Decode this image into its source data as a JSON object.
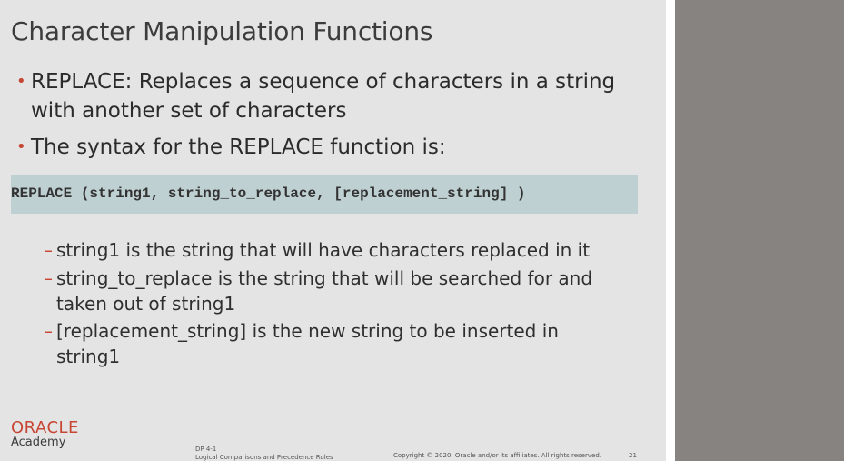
{
  "slide": {
    "title": "Character Manipulation Functions",
    "bullets": [
      {
        "line1": "REPLACE: Replaces a sequence of characters in a string",
        "line2": "with another set of characters"
      },
      {
        "line1": "The syntax for the REPLACE function is:"
      }
    ],
    "code": "REPLACE (string1, string_to_replace, [replacement_string] )",
    "sub_bullets": [
      {
        "line1": "string1 is the string that will have characters replaced in it"
      },
      {
        "line1": "string_to_replace is the string that will be searched for and",
        "line2": "taken out of string1"
      },
      {
        "line1": "[replacement_string] is the new string to be inserted in",
        "line2": "string1"
      }
    ],
    "logo": {
      "brand": "ORACLE",
      "sub": "Academy"
    },
    "footer": {
      "code": "DP 4-1",
      "topic": "Logical Comparisons and Precedence Rules",
      "copyright": "Copyright © 2020, Oracle and/or its affiliates. All rights reserved.",
      "page": "21"
    },
    "colors": {
      "accent": "#c74634",
      "background": "#e4e4e4",
      "code_bg": "#bfd0d3",
      "side_panel": "#878380"
    }
  }
}
